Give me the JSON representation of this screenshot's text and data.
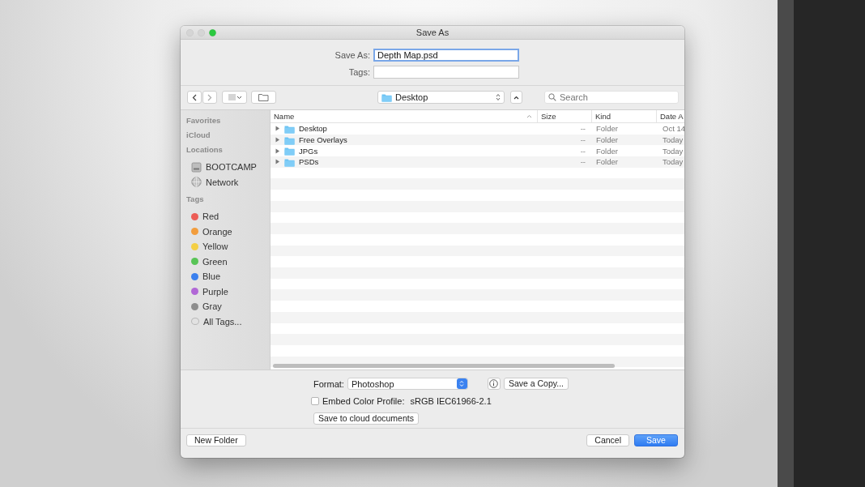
{
  "window": {
    "title": "Save As"
  },
  "save_as": {
    "label": "Save As:",
    "value": "Depth Map.psd"
  },
  "tags_field": {
    "label": "Tags:"
  },
  "toolbar": {
    "location": "Desktop",
    "search_placeholder": "Search"
  },
  "sidebar": [
    {
      "heading": "Favorites"
    },
    {
      "heading": "iCloud"
    },
    {
      "heading": "Locations",
      "items": [
        {
          "label": "BOOTCAMP",
          "kind": "drive"
        },
        {
          "label": "Network",
          "kind": "network"
        }
      ]
    },
    {
      "heading": "Tags",
      "items": [
        {
          "label": "Red",
          "kind": "tag",
          "color": "#ec5c55"
        },
        {
          "label": "Orange",
          "kind": "tag",
          "color": "#f29d3d"
        },
        {
          "label": "Yellow",
          "kind": "tag",
          "color": "#f4cf45"
        },
        {
          "label": "Green",
          "kind": "tag",
          "color": "#58c456"
        },
        {
          "label": "Blue",
          "kind": "tag",
          "color": "#3a80ee"
        },
        {
          "label": "Purple",
          "kind": "tag",
          "color": "#b168d6"
        },
        {
          "label": "Gray",
          "kind": "tag",
          "color": "#8e8e8e"
        },
        {
          "label": "All Tags...",
          "kind": "all-tags"
        }
      ]
    }
  ],
  "table": {
    "columns": [
      "Name",
      "Size",
      "Kind",
      "Date A"
    ],
    "rows": [
      {
        "name": "Desktop",
        "size": "--",
        "kind": "Folder",
        "date": "Oct 14",
        "expanded": false
      },
      {
        "name": "Free Overlays",
        "size": "--",
        "kind": "Folder",
        "date": "Today",
        "expanded": false
      },
      {
        "name": "JPGs",
        "size": "--",
        "kind": "Folder",
        "date": "Today",
        "expanded": false
      },
      {
        "name": "PSDs",
        "size": "--",
        "kind": "Folder",
        "date": "Today",
        "expanded": false
      }
    ]
  },
  "format": {
    "label": "Format:",
    "value": "Photoshop"
  },
  "save_copy_button": "Save a Copy...",
  "embed_profile": {
    "label": "Embed Color Profile:",
    "value": "sRGB IEC61966-2.1",
    "checked": false
  },
  "cloud_button": "Save to cloud documents",
  "buttons": [
    {
      "label": "New Folder",
      "kind": "secondary"
    },
    {
      "label": "Cancel",
      "kind": "secondary"
    },
    {
      "label": "Save",
      "kind": "default"
    }
  ]
}
